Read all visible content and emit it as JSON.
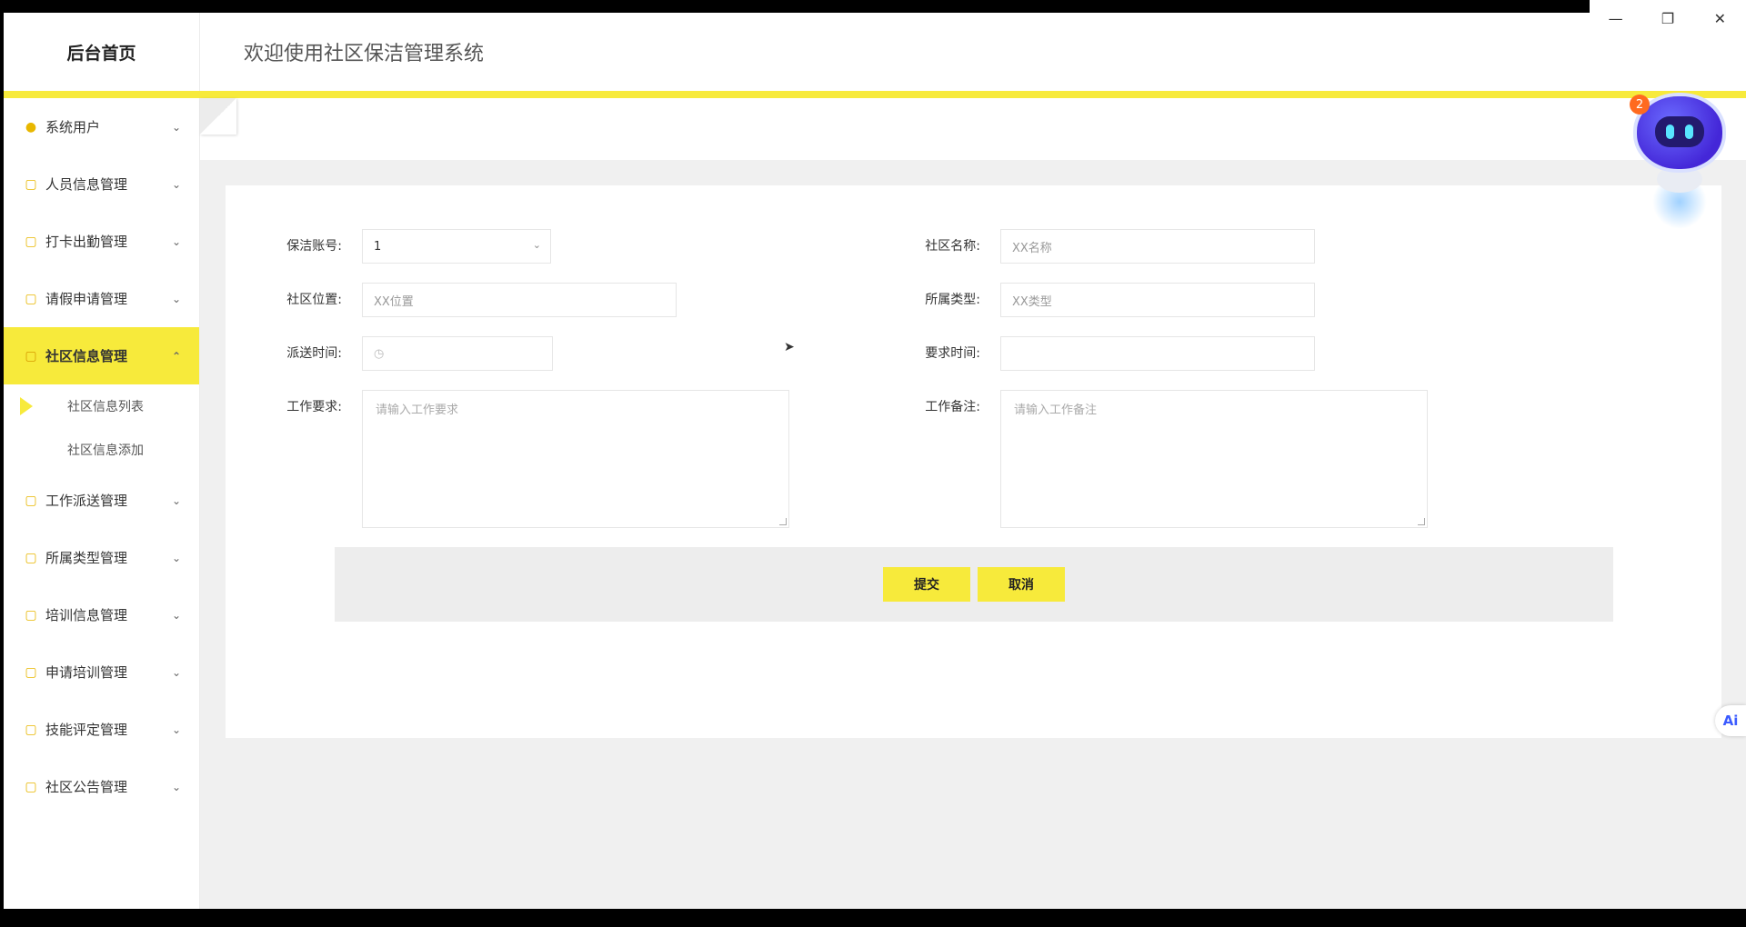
{
  "header": {
    "brand": "后台首页",
    "welcome": "欢迎使用社区保洁管理系统"
  },
  "window_controls": [
    "minimize",
    "restore",
    "close"
  ],
  "sidebar": {
    "items": [
      {
        "label": "系统用户",
        "icon": "user-icon"
      },
      {
        "label": "人员信息管理",
        "icon": "folder-icon"
      },
      {
        "label": "打卡出勤管理",
        "icon": "folder-icon"
      },
      {
        "label": "请假申请管理",
        "icon": "folder-icon"
      },
      {
        "label": "社区信息管理",
        "icon": "folder-icon",
        "active": true
      },
      {
        "label": "工作派送管理",
        "icon": "folder-icon"
      },
      {
        "label": "所属类型管理",
        "icon": "folder-icon"
      },
      {
        "label": "培训信息管理",
        "icon": "folder-icon"
      },
      {
        "label": "申请培训管理",
        "icon": "folder-icon"
      },
      {
        "label": "技能评定管理",
        "icon": "folder-icon"
      },
      {
        "label": "社区公告管理",
        "icon": "folder-icon"
      }
    ],
    "submenu": [
      {
        "label": "社区信息列表",
        "current": true
      },
      {
        "label": "社区信息添加"
      }
    ]
  },
  "form": {
    "account_label": "保洁账号:",
    "account_value": "1",
    "community_name_label": "社区名称:",
    "community_name_placeholder": "XX名称",
    "community_location_label": "社区位置:",
    "community_location_placeholder": "XX位置",
    "type_label": "所属类型:",
    "type_placeholder": "XX类型",
    "dispatch_time_label": "派送时间:",
    "required_time_label": "要求时间:",
    "work_requirement_label": "工作要求:",
    "work_requirement_placeholder": "请输入工作要求",
    "work_note_label": "工作备注:",
    "work_note_placeholder": "请输入工作备注",
    "submit_label": "提交",
    "cancel_label": "取消"
  },
  "assistant": {
    "badge_count": "2",
    "ai_tab_label": "Ai"
  },
  "colors": {
    "accent": "#f7ea3b",
    "icon": "#e8b700",
    "badge": "#ff6a1f"
  }
}
